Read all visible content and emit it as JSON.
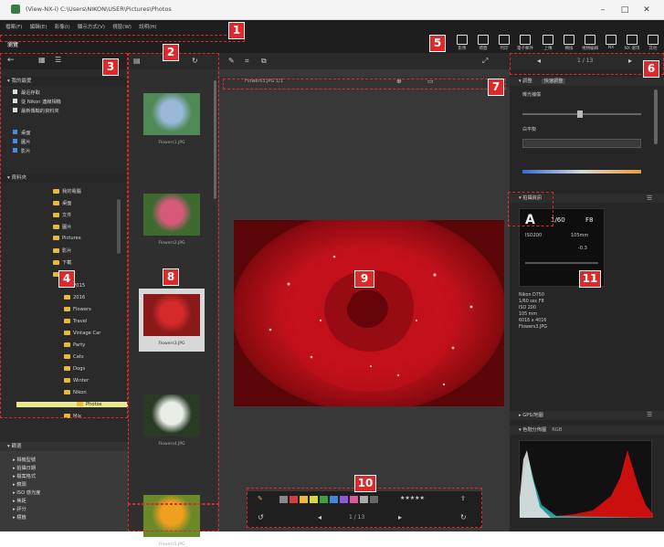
{
  "window": {
    "title": "(View-NX-i)  C:\\Users\\NIKON\\USER\\Pictures\\Photos",
    "minimize": "–",
    "maximize": "□",
    "close": "✕"
  },
  "menubar": [
    "檔案(F)",
    "編輯(E)",
    "影像(I)",
    "顯示方式(V)",
    "視窗(W)",
    "說明(H)"
  ],
  "toolbar": {
    "buttons": [
      {
        "label": "影像",
        "icon": "image-icon"
      },
      {
        "label": "標籤",
        "icon": "tag-icon"
      },
      {
        "label": "列印",
        "icon": "print-icon"
      },
      {
        "label": "電子郵件",
        "icon": "mail-icon"
      },
      {
        "label": "上傳",
        "icon": "upload-icon"
      },
      {
        "label": "轉換",
        "icon": "convert-icon"
      },
      {
        "label": "視頻編輯",
        "icon": "movie-icon"
      },
      {
        "label": "NX",
        "icon": "nx-icon"
      },
      {
        "label": "NX 選項",
        "icon": "options-icon"
      },
      {
        "label": "其他",
        "icon": "more-icon"
      }
    ]
  },
  "left_panel": {
    "browser_tab": "瀏覽",
    "favorites_header": "▾ 我的最愛",
    "favorites": [
      "最近存取",
      "從 Nikon 連線相機",
      "最新傳輸的資料夾"
    ],
    "places": [
      "桌面",
      "圖片",
      "影片"
    ],
    "folders_header": "▾ 資料夾",
    "tree": [
      "我的電腦",
      "桌面",
      "文件",
      "圖片",
      "Pictures",
      "影片",
      "下載",
      "資料",
      "2015",
      "2016",
      "Flowers",
      "Travel",
      "Vintage Car",
      "Party",
      "Cats",
      "Dogs",
      "Winter",
      "Nikon",
      "Photos",
      "Mix"
    ],
    "selected_folder": "Photos",
    "metadata_header": "▾ 篩選",
    "metadata": [
      "相機型號",
      "拍攝日期",
      "檔案格式",
      "鏡頭",
      "ISO 感光度",
      "焦距",
      "評分",
      "標籤"
    ]
  },
  "thumbnails": [
    {
      "name": "Flowers1.JPG",
      "color": "#4f8a56",
      "fg": "#9ab8d8"
    },
    {
      "name": "Flowers2.JPG",
      "color": "#3e6a30",
      "fg": "#d85a7a"
    },
    {
      "name": "Flowers3.JPG",
      "color": "#8a1a1a",
      "fg": "#d42a2a"
    },
    {
      "name": "Flowers4.JPG",
      "color": "#2a3a24",
      "fg": "#e9eee9"
    },
    {
      "name": "Flowers5.JPG",
      "color": "#6a8a2a",
      "fg": "#f0a020"
    }
  ],
  "viewer": {
    "filename": "Flowers3.JPG  1/1",
    "page_indicator": "1 / 13",
    "rating_stars": "★★★★★",
    "label_colors": [
      "#888888",
      "#d83c3c",
      "#e8b93a",
      "#d8d83c",
      "#3ca03c",
      "#3c8ad8",
      "#8a5ad8",
      "#d85aa0",
      "#aaaaaa",
      "#666666"
    ]
  },
  "right_panel": {
    "page": "1 / 13",
    "adjust_header": "▾ 調整",
    "adjust_tab": "快速調整",
    "exposure_label": "曝光補償",
    "wb_label": "白平衡",
    "info_header": "▾ 拍攝資訊",
    "info": {
      "mode": "A",
      "shutter": "1/60",
      "aperture": "F8",
      "iso": "ISO200",
      "focal": "105mm",
      "ev": "-0.3"
    },
    "info_lines": [
      "Nikon D750",
      "1/60 sec  F8",
      "ISO 200",
      "105 mm",
      "6016 x 4016",
      "Flowers3.JPG"
    ],
    "map_header": "▸ GPS/地圖",
    "histogram_header": "▾ 色階分佈圖",
    "histogram_channel": "RGB"
  },
  "markers": [
    "1",
    "2",
    "3",
    "4",
    "5",
    "6",
    "7",
    "8",
    "9",
    "10",
    "11"
  ]
}
